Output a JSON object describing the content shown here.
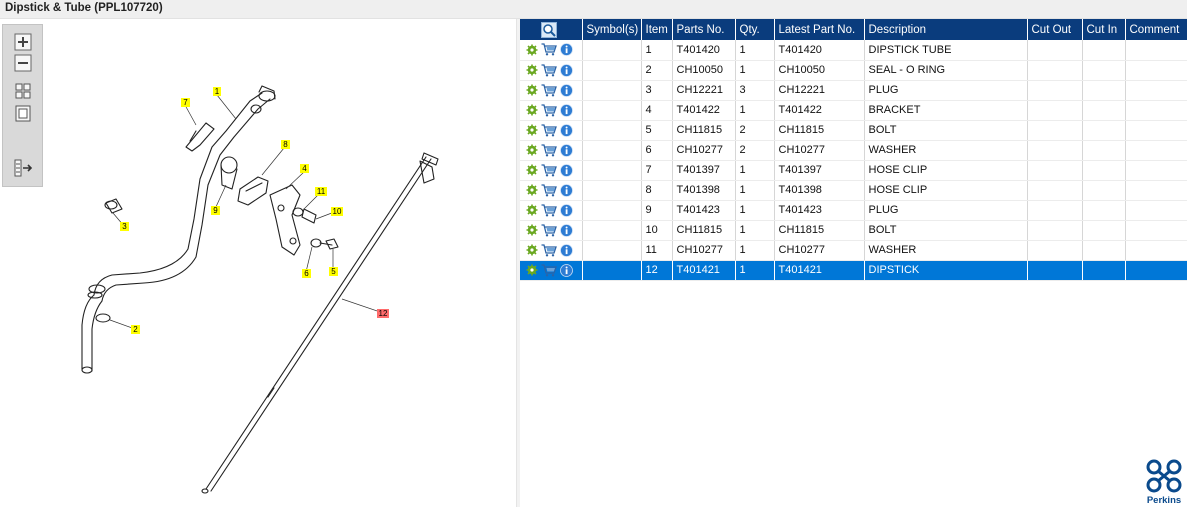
{
  "title": "Dipstick & Tube (PPL107720)",
  "toolbar": {
    "buttons": [
      {
        "name": "zoom-in-button",
        "icon": "plus-icon"
      },
      {
        "name": "zoom-out-button",
        "icon": "minus-icon"
      },
      {
        "name": "fit-page-button",
        "icon": "grid-icon"
      },
      {
        "name": "fit-width-button",
        "icon": "square-icon"
      },
      {
        "name": "export-button",
        "icon": "export-icon"
      }
    ]
  },
  "diagram": {
    "callouts": [
      {
        "label": "1"
      },
      {
        "label": "2"
      },
      {
        "label": "3"
      },
      {
        "label": "4"
      },
      {
        "label": "5"
      },
      {
        "label": "6"
      },
      {
        "label": "7"
      },
      {
        "label": "8"
      },
      {
        "label": "9"
      },
      {
        "label": "10"
      },
      {
        "label": "11"
      },
      {
        "label": "12",
        "highlighted": true
      }
    ],
    "callout_color": "#ffff00",
    "highlight_color": "#ff6b6b"
  },
  "table": {
    "headers": {
      "search": "",
      "symbols": "Symbol(s)",
      "item": "Item",
      "parts_no": "Parts No.",
      "qty": "Qty.",
      "latest_part_no": "Latest Part No.",
      "description": "Description",
      "cut_out": "Cut Out",
      "cut_in": "Cut In",
      "comment": "Comment"
    },
    "rows": [
      {
        "item": "1",
        "parts_no": "T401420",
        "qty": "1",
        "latest": "T401420",
        "description": "DIPSTICK TUBE"
      },
      {
        "item": "2",
        "parts_no": "CH10050",
        "qty": "1",
        "latest": "CH10050",
        "description": "SEAL - O RING"
      },
      {
        "item": "3",
        "parts_no": "CH12221",
        "qty": "3",
        "latest": "CH12221",
        "description": "PLUG"
      },
      {
        "item": "4",
        "parts_no": "T401422",
        "qty": "1",
        "latest": "T401422",
        "description": "BRACKET"
      },
      {
        "item": "5",
        "parts_no": "CH11815",
        "qty": "2",
        "latest": "CH11815",
        "description": "BOLT"
      },
      {
        "item": "6",
        "parts_no": "CH10277",
        "qty": "2",
        "latest": "CH10277",
        "description": "WASHER"
      },
      {
        "item": "7",
        "parts_no": "T401397",
        "qty": "1",
        "latest": "T401397",
        "description": "HOSE CLIP"
      },
      {
        "item": "8",
        "parts_no": "T401398",
        "qty": "1",
        "latest": "T401398",
        "description": "HOSE CLIP"
      },
      {
        "item": "9",
        "parts_no": "T401423",
        "qty": "1",
        "latest": "T401423",
        "description": "PLUG"
      },
      {
        "item": "10",
        "parts_no": "CH11815",
        "qty": "1",
        "latest": "CH11815",
        "description": "BOLT"
      },
      {
        "item": "11",
        "parts_no": "CH10277",
        "qty": "1",
        "latest": "CH10277",
        "description": "WASHER"
      },
      {
        "item": "12",
        "parts_no": "T401421",
        "qty": "1",
        "latest": "T401421",
        "description": "DIPSTICK",
        "selected": true
      }
    ],
    "row_icons": [
      "gear-icon",
      "cart-icon",
      "info-icon"
    ],
    "header_color": "#0a3c7d",
    "selected_color": "#0077d7"
  },
  "brand": {
    "name": "Perkins",
    "color": "#0a4a8c"
  }
}
